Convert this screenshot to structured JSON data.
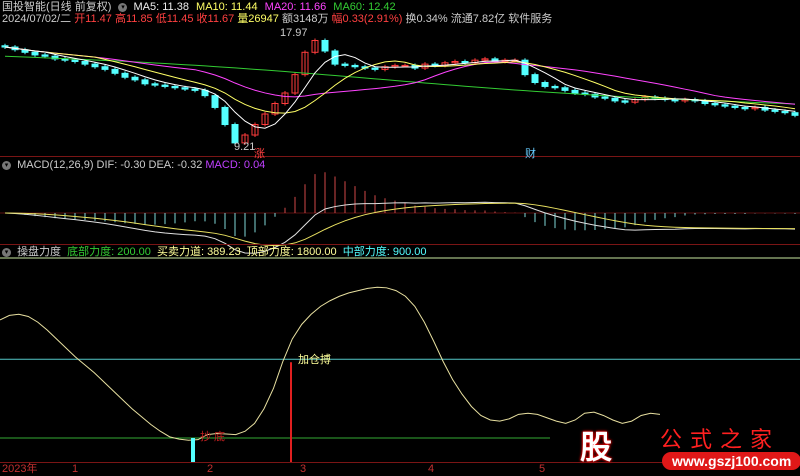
{
  "header": {
    "title": "国投智能(日线 前复权)",
    "ma5": "MA5: 11.38",
    "ma10": "MA10: 11.44",
    "ma20": "MA20: 11.66",
    "ma60": "MA60: 12.42",
    "date": "2024/07/02/二",
    "open": "开11.47",
    "high": "高11.85",
    "low": "低11.45",
    "close": "收11.67",
    "vol": "量26947",
    "amount": "额3148万",
    "change": "幅0.33(2.91%)",
    "turnover": "换0.34%",
    "float": "流通7.82亿",
    "sector": "软件服务"
  },
  "price_chart": {
    "high_label": "17.97",
    "low_label": "9.21",
    "mark_zhang": "涨",
    "mark_cai": "财",
    "closes": [
      16.9,
      16.7,
      16.5,
      16.3,
      16.2,
      16.0,
      15.9,
      15.8,
      15.6,
      15.4,
      15.2,
      14.9,
      14.6,
      14.4,
      14.1,
      14.0,
      13.9,
      13.8,
      13.7,
      13.6,
      13.2,
      12.3,
      11.0,
      9.6,
      10.2,
      11.0,
      11.8,
      12.6,
      13.4,
      14.8,
      16.5,
      17.4,
      16.6,
      15.6,
      15.5,
      15.4,
      15.3,
      15.2,
      15.4,
      15.5,
      15.5,
      15.3,
      15.6,
      15.5,
      15.7,
      15.8,
      15.7,
      15.9,
      16.0,
      15.8,
      15.9,
      15.9,
      14.8,
      14.2,
      13.9,
      13.8,
      13.6,
      13.4,
      13.3,
      13.1,
      13.0,
      12.8,
      12.7,
      12.9,
      13.1,
      13.0,
      12.9,
      12.8,
      12.9,
      12.8,
      12.6,
      12.5,
      12.4,
      12.3,
      12.2,
      12.3,
      12.1,
      12.0,
      11.9,
      11.7
    ]
  },
  "macd": {
    "title": "MACD(12,26,9)",
    "dif": "DIF: -0.30",
    "dea": "DEA: -0.32",
    "macd": "MACD: 0.04"
  },
  "indicator": {
    "title": "操盘力度",
    "bottom": "底部力度: 200.00",
    "trade": "买卖力道: 389.23",
    "top": "顶部力度: 1800.00",
    "mid": "中部力度: 900.00",
    "signal_add": "加仓搏",
    "signal_bottom": "抄 底",
    "curve": [
      1250,
      1290,
      1300,
      1280,
      1230,
      1160,
      1080,
      1000,
      920,
      850,
      780,
      700,
      620,
      540,
      460,
      390,
      320,
      260,
      210,
      190,
      180,
      185,
      230,
      240,
      235,
      230,
      260,
      330,
      460,
      640,
      880,
      1080,
      1210,
      1300,
      1370,
      1420,
      1460,
      1490,
      1510,
      1530,
      1540,
      1535,
      1510,
      1460,
      1370,
      1230,
      1060,
      880,
      720,
      590,
      480,
      400,
      360,
      350,
      370,
      410,
      420,
      410,
      380,
      350,
      330,
      360,
      420,
      430,
      400,
      360,
      330,
      350,
      400,
      420,
      410
    ]
  },
  "axis": {
    "labels": [
      "2023年",
      "1",
      "2",
      "3",
      "4",
      "5"
    ]
  },
  "watermark": {
    "logo": "股",
    "name": "公式之家",
    "url": "www.gszj100.com"
  },
  "colors": {
    "up": "#ff3c3c",
    "down": "#54ffff",
    "ma5": "#ffffff",
    "ma10": "#ffff66",
    "ma20": "#ff44ff",
    "ma60": "#33cc33"
  }
}
